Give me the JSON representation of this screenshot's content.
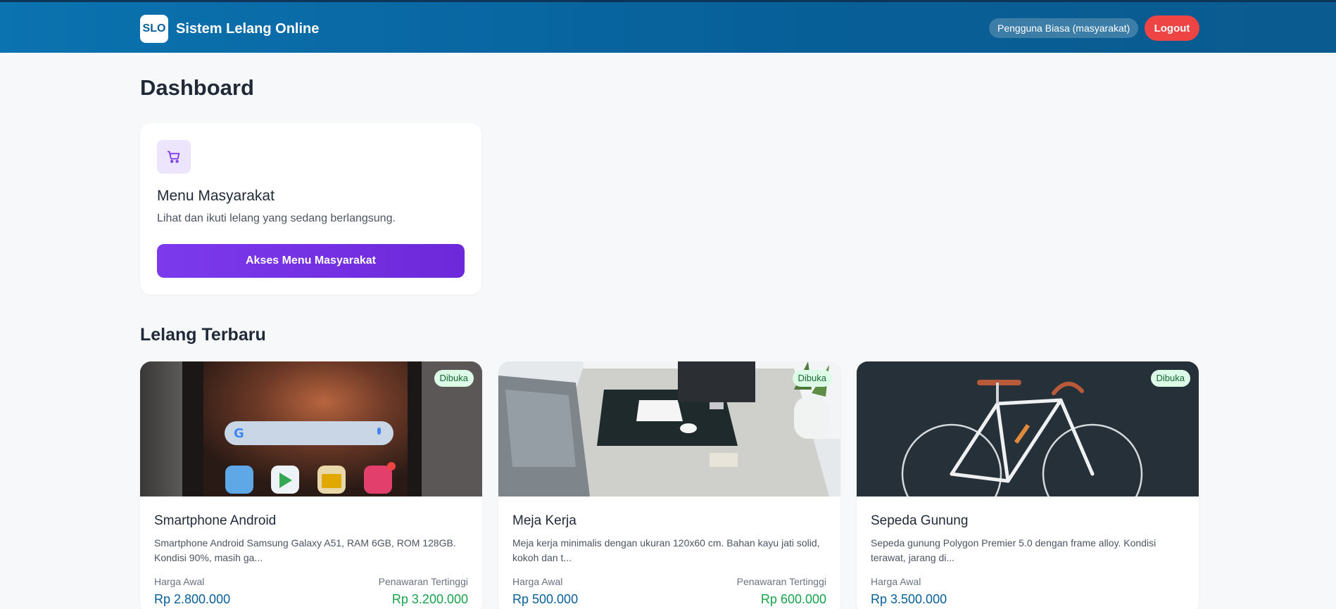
{
  "header": {
    "logo_text": "SLO",
    "title": "Sistem Lelang Online",
    "user_role": "Pengguna Biasa (masyarakat)",
    "logout_label": "Logout"
  },
  "page": {
    "title": "Dashboard"
  },
  "menu_card": {
    "icon": "shopping-cart-icon",
    "title": "Menu Masyarakat",
    "description": "Lihat dan ikuti lelang yang sedang berlangsung.",
    "button_label": "Akses Menu Masyarakat"
  },
  "latest": {
    "title": "Lelang Terbaru",
    "items": [
      {
        "status": "Dibuka",
        "image": "smartphone-photo",
        "title": "Smartphone Android",
        "description": "Smartphone Android Samsung Galaxy A51, RAM 6GB, ROM 128GB. Kondisi 90%, masih ga...",
        "start_label": "Harga Awal",
        "start_price": "Rp 2.800.000",
        "high_label": "Penawaran Tertinggi",
        "high_price": "Rp 3.200.000"
      },
      {
        "status": "Dibuka",
        "image": "desk-photo",
        "title": "Meja Kerja",
        "description": "Meja kerja minimalis dengan ukuran 120x60 cm. Bahan kayu jati solid, kokoh dan t...",
        "start_label": "Harga Awal",
        "start_price": "Rp 500.000",
        "high_label": "Penawaran Tertinggi",
        "high_price": "Rp 600.000"
      },
      {
        "status": "Dibuka",
        "image": "bicycle-photo",
        "title": "Sepeda Gunung",
        "description": "Sepeda gunung Polygon Premier 5.0 dengan frame alloy. Kondisi terawat, jarang di...",
        "start_label": "Harga Awal",
        "start_price": "Rp 3.500.000"
      }
    ]
  },
  "colors": {
    "navbar": "#075f98",
    "logout": "#ef4444",
    "accent_purple": "#7c3aed",
    "price_start": "#075f98",
    "price_high": "#16a34a",
    "status_bg": "#dcfce7"
  }
}
